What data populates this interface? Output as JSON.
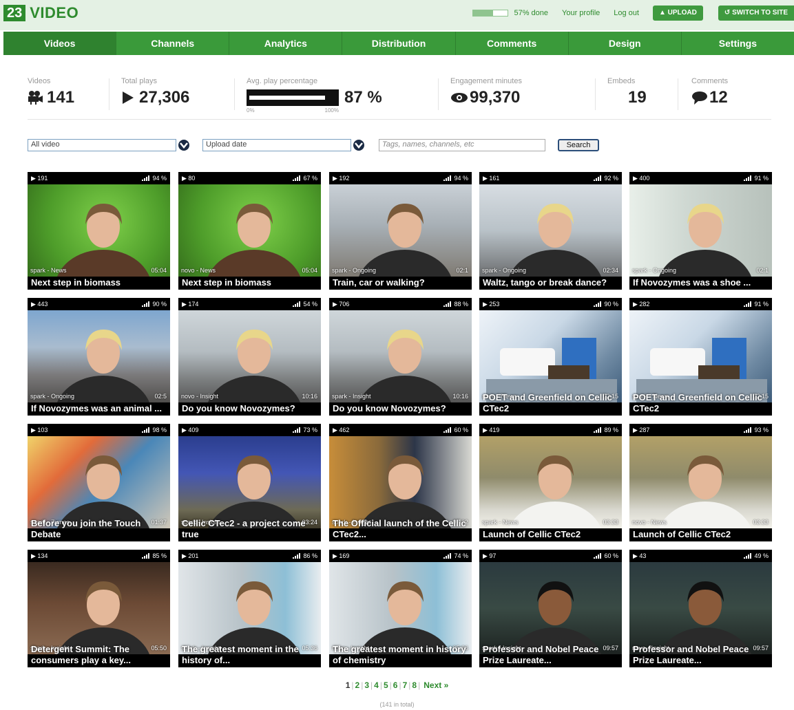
{
  "header": {
    "logo_number": "23",
    "logo_text": "VIDEO",
    "quota_text": "57% done",
    "quota_fraction": 0.57,
    "links": [
      "Your profile",
      "Log out"
    ],
    "upload_label": "UPLOAD",
    "switch_label": "SWITCH TO SITE"
  },
  "nav": {
    "items": [
      "Videos",
      "Channels",
      "Analytics",
      "Distribution",
      "Comments",
      "Design",
      "Settings"
    ],
    "active": 0
  },
  "stats": {
    "videos_label": "Videos",
    "videos_value": "141",
    "plays_label": "Total plays",
    "plays_value": "27,306",
    "avg_label": "Avg. play percentage",
    "avg_value": "87 %",
    "avg_fraction": 0.87,
    "avg_tick_min": "0%",
    "avg_tick_max": "100%",
    "engagement_label": "Engagement minutes",
    "engagement_value": "99,370",
    "embeds_label": "Embeds",
    "embeds_value": "19",
    "comments_label": "Comments",
    "comments_value": "12"
  },
  "filters": {
    "video_select": "All video",
    "sort_select": "Upload date",
    "search_placeholder": "Tags, names, channels, etc",
    "search_button": "Search"
  },
  "videos": [
    {
      "plays": "191",
      "pct": "94 %",
      "channel": "spark - News",
      "duration": "05:04",
      "title": "Next step in biomass",
      "bg": "green"
    },
    {
      "plays": "80",
      "pct": "67 %",
      "channel": "novo - News",
      "duration": "05:04",
      "title": "Next step in biomass",
      "bg": "green"
    },
    {
      "plays": "192",
      "pct": "94 %",
      "channel": "spark - Ongoing",
      "duration": "02:1",
      "title": "Train, car or walking?",
      "bg": "office"
    },
    {
      "plays": "161",
      "pct": "92 %",
      "channel": "spark - Ongoing",
      "duration": "02:34",
      "title": "Waltz, tango or break dance?",
      "bg": "office2"
    },
    {
      "plays": "400",
      "pct": "91 %",
      "channel": "spark - Ongoing",
      "duration": "02:1",
      "title": "If Novozymes was a shoe ...",
      "bg": "window"
    },
    {
      "plays": "443",
      "pct": "90 %",
      "channel": "spark - Ongoing",
      "duration": "02:5",
      "title": "If Novozymes was an animal ...",
      "bg": "street"
    },
    {
      "plays": "174",
      "pct": "54 %",
      "channel": "novo - Insight",
      "duration": "10:16",
      "title": "Do you know Novozymes?",
      "bg": "street2"
    },
    {
      "plays": "706",
      "pct": "88 %",
      "channel": "spark - Insight",
      "duration": "10:16",
      "title": "Do you know Novozymes?",
      "bg": "street2"
    },
    {
      "plays": "253",
      "pct": "90 %",
      "channel": "novo - News",
      "duration": "02:15",
      "title": "POET and Greenfield on Cellic CTec2",
      "bg": "lab"
    },
    {
      "plays": "282",
      "pct": "91 %",
      "channel": "spark - News",
      "duration": "02:15",
      "title": "POET and Greenfield on Cellic CTec2",
      "bg": "lab"
    },
    {
      "plays": "103",
      "pct": "98 %",
      "channel": "spark - Zymes",
      "duration": "01:37",
      "title": "Before you join the Touch Debate",
      "bg": "art"
    },
    {
      "plays": "409",
      "pct": "73 %",
      "channel": "spark - Insight",
      "duration": "03:24",
      "title": "Cellic CTec2 - a project come true",
      "bg": "blue"
    },
    {
      "plays": "462",
      "pct": "60 %",
      "channel": "spark - Insight",
      "duration": "02:22",
      "title": "The Official launch of the Cellic CTec2...",
      "bg": "stage"
    },
    {
      "plays": "419",
      "pct": "89 %",
      "channel": "spark - News",
      "duration": "03:33",
      "title": "Launch of Cellic CTec2",
      "bg": "cellic"
    },
    {
      "plays": "287",
      "pct": "93 %",
      "channel": "novo - News",
      "duration": "03:33",
      "title": "Launch of Cellic CTec2",
      "bg": "cellic"
    },
    {
      "plays": "134",
      "pct": "85 %",
      "channel": "spark - Insight",
      "duration": "05:50",
      "title": "Detergent Summit: The consumers play a key...",
      "bg": "meeting"
    },
    {
      "plays": "201",
      "pct": "86 %",
      "channel": "spark - Insight",
      "duration": "05:36",
      "title": "The greatest moment in the history of...",
      "bg": "hall"
    },
    {
      "plays": "169",
      "pct": "74 %",
      "channel": "novo - Insight",
      "duration": "05:36",
      "title": "The greatest moment in history of chemistry",
      "bg": "hall"
    },
    {
      "plays": "97",
      "pct": "60 %",
      "channel": "spark - Insight",
      "duration": "09:57",
      "title": "Professor and Nobel Peace Prize Laureate...",
      "bg": "dark"
    },
    {
      "plays": "43",
      "pct": "49 %",
      "channel": "novo - Insight",
      "duration": "09:57",
      "title": "Professor and Nobel Peace Prize Laureate...",
      "bg": "dark"
    }
  ],
  "pagination": {
    "pages": [
      "1",
      "2",
      "3",
      "4",
      "5",
      "6",
      "7",
      "8"
    ],
    "current": "1",
    "next_label": "Next »",
    "total_text": "(141 in total)"
  }
}
